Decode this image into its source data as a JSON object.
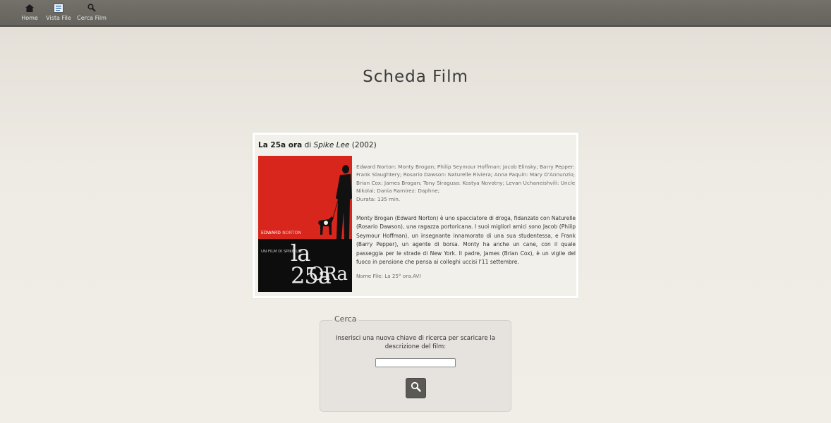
{
  "nav": {
    "items": [
      {
        "label": "Home",
        "icon": "home-icon"
      },
      {
        "label": "Vista File",
        "icon": "file-list-icon"
      },
      {
        "label": "Cerca Film",
        "icon": "search-icon"
      }
    ]
  },
  "page": {
    "title": "Scheda Film"
  },
  "film": {
    "title": "La 25a ora",
    "by": "di",
    "director": "Spike Lee",
    "year": "(2002)",
    "poster": {
      "actor_first": "EDWARD",
      "actor_last": "NORTON",
      "director_credit": "UN FILM DI SPIKE LEE",
      "title_line1": "la 25a",
      "title_line2": "ORa"
    },
    "cast": "Edward Norton: Monty Brogan; Philip Seymour Hoffman: Jacob Elinsky; Barry Pepper: Frank Slaughtery; Rosario Dawson: Naturelle Riviera; Anna Paquin: Mary D'Annunzio; Brian Cox: James Brogan; Tony Siragusa: Kostya Novotny; Levan Uchaneishvili: Uncle Nikolai; Dania Ramirez: Daphne;",
    "duration": "Durata: 135 min.",
    "plot": "Monty Brogan (Edward Norton) è uno spacciatore di droga, fidanzato con Naturelle (Rosario Dawson), una ragazza portoricana. I suoi migliori amici sono Jacob (Philip Seymour Hoffman), un insegnante innamorato di una sua studentessa, e Frank (Barry Pepper), un agente di borsa. Monty ha anche un cane, con il quale passeggia per le strade di New York. Il padre, James (Brian Cox), è un vigile del fuoco in pensione che pensa ai colleghi uccisi l'11 settembre.",
    "filename": "Nome File: La 25° ora.AVI"
  },
  "search": {
    "legend": "Cerca",
    "description": "Inserisci una nuova chiave di ricerca per scaricare la descrizione del film:",
    "value": "",
    "button_icon": "search-icon"
  },
  "colors": {
    "topbar": "#6b6862",
    "poster_red": "#d8261d",
    "button": "#5b5955"
  }
}
